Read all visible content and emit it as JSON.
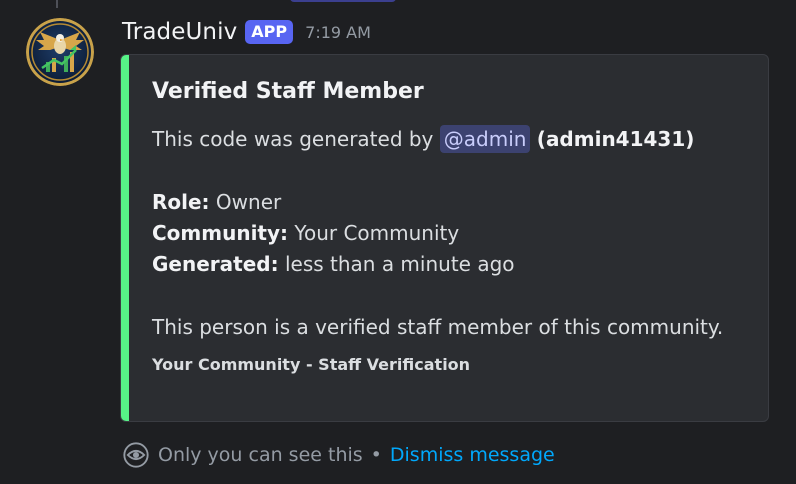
{
  "message": {
    "username": "TradeUniv",
    "badge": "APP",
    "timestamp": "7:19 AM",
    "avatar_icon": "eagle-trading-logo-icon"
  },
  "embed": {
    "accent_color": "#57f287",
    "title": "Verified Staff Member",
    "generated_by_prefix": "This code was generated by",
    "mention": "@admin",
    "username_paren": "(admin41431)",
    "role_label": "Role:",
    "role_value": "Owner",
    "community_label": "Community:",
    "community_value": "Your Community",
    "generated_label": "Generated:",
    "generated_value": "less than a minute ago",
    "description": "This person is a verified staff member of this community.",
    "footer": "Your Community - Staff Verification"
  },
  "ephemeral": {
    "icon": "eye-icon",
    "text": "Only you can see this",
    "separator": "•",
    "dismiss_label": "Dismiss message"
  }
}
